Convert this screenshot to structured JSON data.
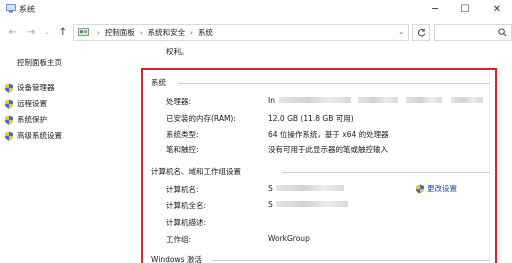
{
  "window": {
    "title": "系统"
  },
  "address": {
    "crumbs": [
      "控制面板",
      "系统和安全",
      "系统"
    ]
  },
  "sidebar": {
    "home": "控制面板主页",
    "items": [
      {
        "label": "设备管理器"
      },
      {
        "label": "远程设置"
      },
      {
        "label": "系统保护"
      },
      {
        "label": "高级系统设置"
      }
    ]
  },
  "main": {
    "top_text": "权利。",
    "system_section": {
      "title": "系统",
      "rows": [
        {
          "label": "处理器:",
          "value": "In"
        },
        {
          "label": "已安装的内存(RAM):",
          "value": "12.0 GB (11.8 GB 可用)"
        },
        {
          "label": "系统类型:",
          "value": "64 位操作系统，基于 x64 的处理器"
        },
        {
          "label": "笔和触控:",
          "value": "没有可用于此显示器的笔或触控输入"
        }
      ]
    },
    "computer_section": {
      "title": "计算机名、域和工作组设置",
      "change_label": "更改设置",
      "rows": [
        {
          "label": "计算机名:",
          "value": "S"
        },
        {
          "label": "计算机全名:",
          "value": "S"
        },
        {
          "label": "计算机描述:",
          "value": ""
        },
        {
          "label": "工作组:",
          "value": "WorkGroup"
        }
      ]
    },
    "activation_section": {
      "title": "Windows 激活"
    }
  },
  "colors": {
    "highlight_frame": "#d9252a",
    "link": "#1a4fa0"
  }
}
